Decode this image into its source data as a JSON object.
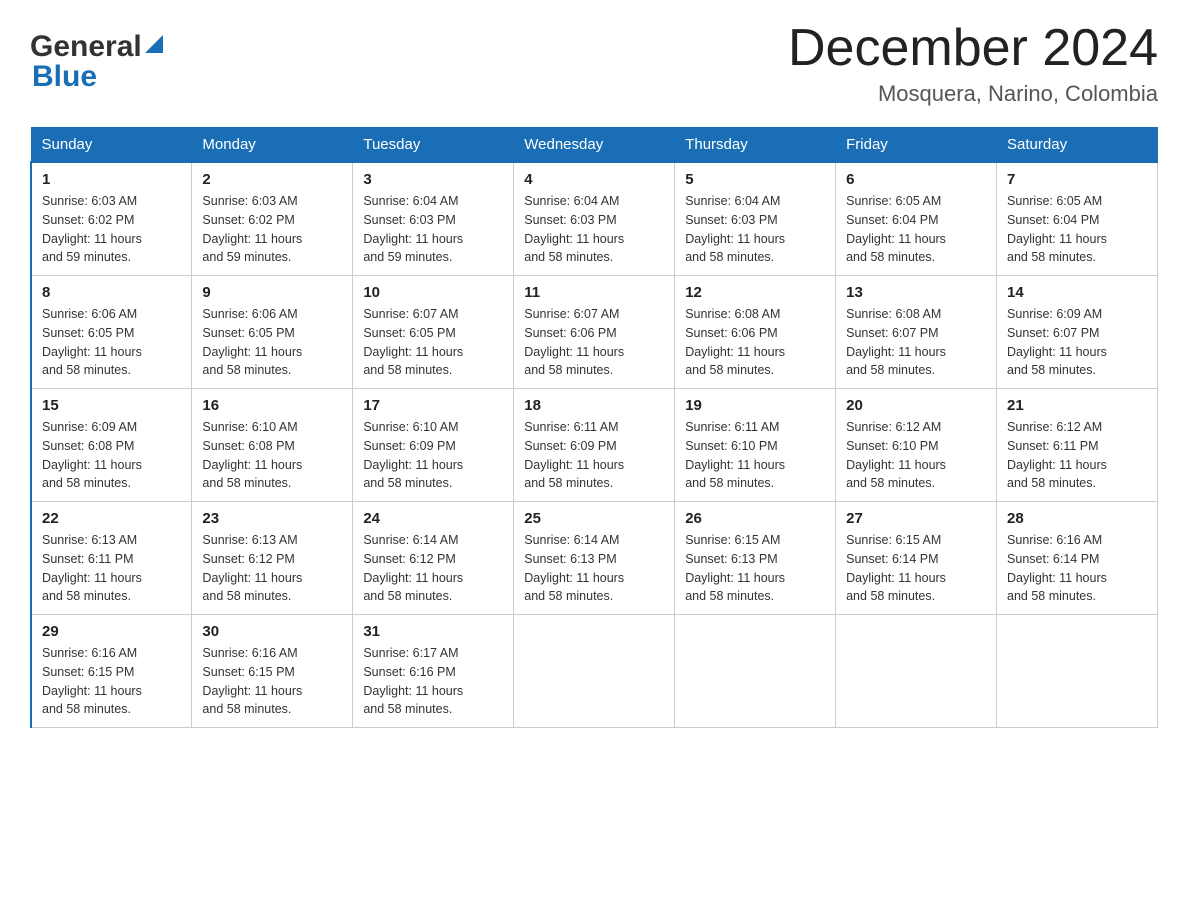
{
  "logo": {
    "general": "General",
    "blue": "Blue",
    "tagline": ""
  },
  "header": {
    "month": "December 2024",
    "location": "Mosquera, Narino, Colombia"
  },
  "days_of_week": [
    "Sunday",
    "Monday",
    "Tuesday",
    "Wednesday",
    "Thursday",
    "Friday",
    "Saturday"
  ],
  "weeks": [
    [
      {
        "day": "1",
        "sunrise": "6:03 AM",
        "sunset": "6:02 PM",
        "daylight": "11 hours and 59 minutes."
      },
      {
        "day": "2",
        "sunrise": "6:03 AM",
        "sunset": "6:02 PM",
        "daylight": "11 hours and 59 minutes."
      },
      {
        "day": "3",
        "sunrise": "6:04 AM",
        "sunset": "6:03 PM",
        "daylight": "11 hours and 59 minutes."
      },
      {
        "day": "4",
        "sunrise": "6:04 AM",
        "sunset": "6:03 PM",
        "daylight": "11 hours and 58 minutes."
      },
      {
        "day": "5",
        "sunrise": "6:04 AM",
        "sunset": "6:03 PM",
        "daylight": "11 hours and 58 minutes."
      },
      {
        "day": "6",
        "sunrise": "6:05 AM",
        "sunset": "6:04 PM",
        "daylight": "11 hours and 58 minutes."
      },
      {
        "day": "7",
        "sunrise": "6:05 AM",
        "sunset": "6:04 PM",
        "daylight": "11 hours and 58 minutes."
      }
    ],
    [
      {
        "day": "8",
        "sunrise": "6:06 AM",
        "sunset": "6:05 PM",
        "daylight": "11 hours and 58 minutes."
      },
      {
        "day": "9",
        "sunrise": "6:06 AM",
        "sunset": "6:05 PM",
        "daylight": "11 hours and 58 minutes."
      },
      {
        "day": "10",
        "sunrise": "6:07 AM",
        "sunset": "6:05 PM",
        "daylight": "11 hours and 58 minutes."
      },
      {
        "day": "11",
        "sunrise": "6:07 AM",
        "sunset": "6:06 PM",
        "daylight": "11 hours and 58 minutes."
      },
      {
        "day": "12",
        "sunrise": "6:08 AM",
        "sunset": "6:06 PM",
        "daylight": "11 hours and 58 minutes."
      },
      {
        "day": "13",
        "sunrise": "6:08 AM",
        "sunset": "6:07 PM",
        "daylight": "11 hours and 58 minutes."
      },
      {
        "day": "14",
        "sunrise": "6:09 AM",
        "sunset": "6:07 PM",
        "daylight": "11 hours and 58 minutes."
      }
    ],
    [
      {
        "day": "15",
        "sunrise": "6:09 AM",
        "sunset": "6:08 PM",
        "daylight": "11 hours and 58 minutes."
      },
      {
        "day": "16",
        "sunrise": "6:10 AM",
        "sunset": "6:08 PM",
        "daylight": "11 hours and 58 minutes."
      },
      {
        "day": "17",
        "sunrise": "6:10 AM",
        "sunset": "6:09 PM",
        "daylight": "11 hours and 58 minutes."
      },
      {
        "day": "18",
        "sunrise": "6:11 AM",
        "sunset": "6:09 PM",
        "daylight": "11 hours and 58 minutes."
      },
      {
        "day": "19",
        "sunrise": "6:11 AM",
        "sunset": "6:10 PM",
        "daylight": "11 hours and 58 minutes."
      },
      {
        "day": "20",
        "sunrise": "6:12 AM",
        "sunset": "6:10 PM",
        "daylight": "11 hours and 58 minutes."
      },
      {
        "day": "21",
        "sunrise": "6:12 AM",
        "sunset": "6:11 PM",
        "daylight": "11 hours and 58 minutes."
      }
    ],
    [
      {
        "day": "22",
        "sunrise": "6:13 AM",
        "sunset": "6:11 PM",
        "daylight": "11 hours and 58 minutes."
      },
      {
        "day": "23",
        "sunrise": "6:13 AM",
        "sunset": "6:12 PM",
        "daylight": "11 hours and 58 minutes."
      },
      {
        "day": "24",
        "sunrise": "6:14 AM",
        "sunset": "6:12 PM",
        "daylight": "11 hours and 58 minutes."
      },
      {
        "day": "25",
        "sunrise": "6:14 AM",
        "sunset": "6:13 PM",
        "daylight": "11 hours and 58 minutes."
      },
      {
        "day": "26",
        "sunrise": "6:15 AM",
        "sunset": "6:13 PM",
        "daylight": "11 hours and 58 minutes."
      },
      {
        "day": "27",
        "sunrise": "6:15 AM",
        "sunset": "6:14 PM",
        "daylight": "11 hours and 58 minutes."
      },
      {
        "day": "28",
        "sunrise": "6:16 AM",
        "sunset": "6:14 PM",
        "daylight": "11 hours and 58 minutes."
      }
    ],
    [
      {
        "day": "29",
        "sunrise": "6:16 AM",
        "sunset": "6:15 PM",
        "daylight": "11 hours and 58 minutes."
      },
      {
        "day": "30",
        "sunrise": "6:16 AM",
        "sunset": "6:15 PM",
        "daylight": "11 hours and 58 minutes."
      },
      {
        "day": "31",
        "sunrise": "6:17 AM",
        "sunset": "6:16 PM",
        "daylight": "11 hours and 58 minutes."
      },
      null,
      null,
      null,
      null
    ]
  ],
  "labels": {
    "sunrise": "Sunrise:",
    "sunset": "Sunset:",
    "daylight": "Daylight:"
  }
}
